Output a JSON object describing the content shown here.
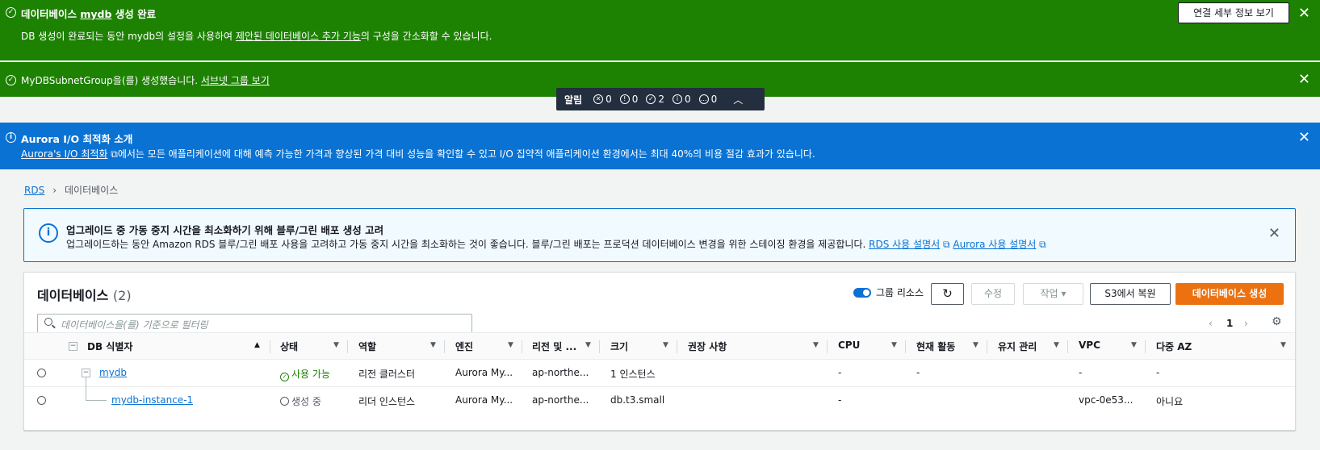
{
  "flash1": {
    "title_prefix": "데이터베이스 ",
    "title_db": "mydb",
    "title_suffix": " 생성 완료",
    "body_prefix": "DB 생성이 완료되는 동안 mydb의 설정을 사용하여 ",
    "body_link": "제안된 데이터베이스 추가 기능",
    "body_suffix": "의 구성을 간소화할 수 있습니다.",
    "button": "연결 세부 정보 보기"
  },
  "flash2": {
    "text": "MyDBSubnetGroup을(를) 생성했습니다. ",
    "link": "서브넷 그룹 보기"
  },
  "notifications": {
    "label": "알림",
    "errors": "0",
    "warnings": "0",
    "success": "2",
    "info": "0",
    "inprogress": "0"
  },
  "flash3": {
    "title": "Aurora I/O 최적화 소개",
    "link": "Aurora's I/O 최적화",
    "body": "에서는 모든 애플리케이션에 대해 예측 가능한 가격과 향상된 가격 대비 성능을 확인할 수 있고 I/O 집약적 애플리케이션 환경에서는 최대 40%의 비용 절감 효과가 있습니다."
  },
  "breadcrumb": {
    "root": "RDS",
    "current": "데이터베이스"
  },
  "info": {
    "title": "업그레이드 중 가동 중지 시간을 최소화하기 위해 블루/그린 배포 생성 고려",
    "body": "업그레이드하는 동안 Amazon RDS 블루/그린 배포 사용을 고려하고 가동 중지 시간을 최소화하는 것이 좋습니다. 블루/그린 배포는 프로덕션 데이터베이스 변경을 위한 스테이징 환경을 제공합니다.",
    "link1": "RDS 사용 설명서",
    "link2": "Aurora 사용 설명서"
  },
  "panel": {
    "title": "데이터베이스",
    "count": "(2)",
    "group_resources": "그룹 리소스",
    "modify": "수정",
    "actions": "작업",
    "restore_s3": "S3에서 복원",
    "create": "데이터베이스 생성",
    "search_placeholder": "데이터베이스을(를) 기준으로 필터링",
    "page": "1"
  },
  "columns": {
    "db_id": "DB 식별자",
    "status": "상태",
    "role": "역할",
    "engine": "엔진",
    "region": "리전 및 ...",
    "size": "크기",
    "recommendations": "권장 사항",
    "cpu": "CPU",
    "activity": "현재 활동",
    "maintenance": "유지 관리",
    "vpc": "VPC",
    "multi_az": "다중 AZ"
  },
  "rows": [
    {
      "id": "mydb",
      "status": "사용 가능",
      "role": "리전 클러스터",
      "engine": "Aurora My...",
      "region": "ap-northe...",
      "size": "1 인스턴스",
      "cpu": "-",
      "activity": "-",
      "vpc": "-",
      "multi_az": "-"
    },
    {
      "id": "mydb-instance-1",
      "status": "생성 중",
      "role": "리더 인스턴스",
      "engine": "Aurora My...",
      "region": "ap-northe...",
      "size": "db.t3.small",
      "cpu": "-",
      "activity": "",
      "vpc": "vpc-0e53...",
      "multi_az": "아니요"
    }
  ],
  "colors": {
    "success_green": "#1d8102",
    "info_blue": "#0972d3",
    "primary_orange": "#ec7211",
    "notification_dark": "#232f3e"
  }
}
